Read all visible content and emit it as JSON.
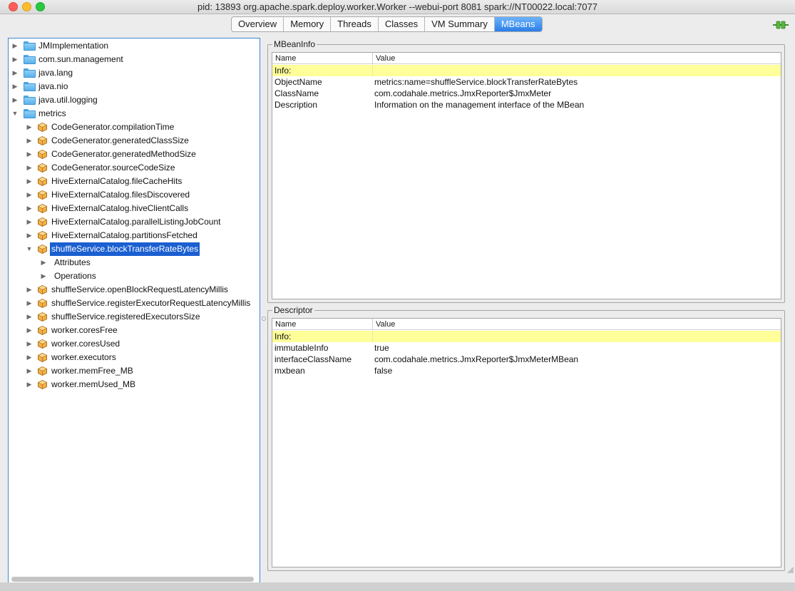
{
  "window": {
    "title": "pid: 13893 org.apache.spark.deploy.worker.Worker --webui-port 8081 spark://NT00022.local:7077"
  },
  "tabs": [
    {
      "label": "Overview"
    },
    {
      "label": "Memory"
    },
    {
      "label": "Threads"
    },
    {
      "label": "Classes"
    },
    {
      "label": "VM Summary"
    },
    {
      "label": "MBeans",
      "active": true
    }
  ],
  "tree": {
    "items": [
      {
        "label": "JMImplementation",
        "type": "folder",
        "level": 0,
        "expanded": false
      },
      {
        "label": "com.sun.management",
        "type": "folder",
        "level": 0,
        "expanded": false
      },
      {
        "label": "java.lang",
        "type": "folder",
        "level": 0,
        "expanded": false
      },
      {
        "label": "java.nio",
        "type": "folder",
        "level": 0,
        "expanded": false
      },
      {
        "label": "java.util.logging",
        "type": "folder",
        "level": 0,
        "expanded": false
      },
      {
        "label": "metrics",
        "type": "folder-open",
        "level": 0,
        "expanded": true
      },
      {
        "label": "CodeGenerator.compilationTime",
        "type": "bean",
        "level": 1,
        "expanded": false
      },
      {
        "label": "CodeGenerator.generatedClassSize",
        "type": "bean",
        "level": 1,
        "expanded": false
      },
      {
        "label": "CodeGenerator.generatedMethodSize",
        "type": "bean",
        "level": 1,
        "expanded": false
      },
      {
        "label": "CodeGenerator.sourceCodeSize",
        "type": "bean",
        "level": 1,
        "expanded": false
      },
      {
        "label": "HiveExternalCatalog.fileCacheHits",
        "type": "bean",
        "level": 1,
        "expanded": false
      },
      {
        "label": "HiveExternalCatalog.filesDiscovered",
        "type": "bean",
        "level": 1,
        "expanded": false
      },
      {
        "label": "HiveExternalCatalog.hiveClientCalls",
        "type": "bean",
        "level": 1,
        "expanded": false
      },
      {
        "label": "HiveExternalCatalog.parallelListingJobCount",
        "type": "bean",
        "level": 1,
        "expanded": false
      },
      {
        "label": "HiveExternalCatalog.partitionsFetched",
        "type": "bean",
        "level": 1,
        "expanded": false
      },
      {
        "label": "shuffleService.blockTransferRateBytes",
        "type": "bean",
        "level": 1,
        "expanded": true,
        "selected": true
      },
      {
        "label": "Attributes",
        "type": "node",
        "level": 2,
        "expanded": false
      },
      {
        "label": "Operations",
        "type": "node",
        "level": 2,
        "expanded": false
      },
      {
        "label": "shuffleService.openBlockRequestLatencyMillis",
        "type": "bean",
        "level": 1,
        "expanded": false
      },
      {
        "label": "shuffleService.registerExecutorRequestLatencyMillis",
        "type": "bean",
        "level": 1,
        "expanded": false
      },
      {
        "label": "shuffleService.registeredExecutorsSize",
        "type": "bean",
        "level": 1,
        "expanded": false
      },
      {
        "label": "worker.coresFree",
        "type": "bean",
        "level": 1,
        "expanded": false
      },
      {
        "label": "worker.coresUsed",
        "type": "bean",
        "level": 1,
        "expanded": false
      },
      {
        "label": "worker.executors",
        "type": "bean",
        "level": 1,
        "expanded": false
      },
      {
        "label": "worker.memFree_MB",
        "type": "bean",
        "level": 1,
        "expanded": false
      },
      {
        "label": "worker.memUsed_MB",
        "type": "bean",
        "level": 1,
        "expanded": false
      }
    ]
  },
  "mbeaninfo": {
    "title": "MBeanInfo",
    "columns": [
      "Name",
      "Value"
    ],
    "info_label": "Info:",
    "rows": [
      {
        "name": "ObjectName",
        "value": "metrics:name=shuffleService.blockTransferRateBytes"
      },
      {
        "name": "ClassName",
        "value": "com.codahale.metrics.JmxReporter$JmxMeter"
      },
      {
        "name": "Description",
        "value": "Information on the management interface of the MBean"
      }
    ]
  },
  "descriptor": {
    "title": "Descriptor",
    "columns": [
      "Name",
      "Value"
    ],
    "info_label": "Info:",
    "rows": [
      {
        "name": "immutableInfo",
        "value": "true"
      },
      {
        "name": "interfaceClassName",
        "value": "com.codahale.metrics.JmxReporter$JmxMeterMBean"
      },
      {
        "name": "mxbean",
        "value": "false"
      }
    ]
  },
  "colors": {
    "selection": "#1b5fd1",
    "info_highlight": "#ffff99",
    "active_tab": "#2a7ee8"
  }
}
